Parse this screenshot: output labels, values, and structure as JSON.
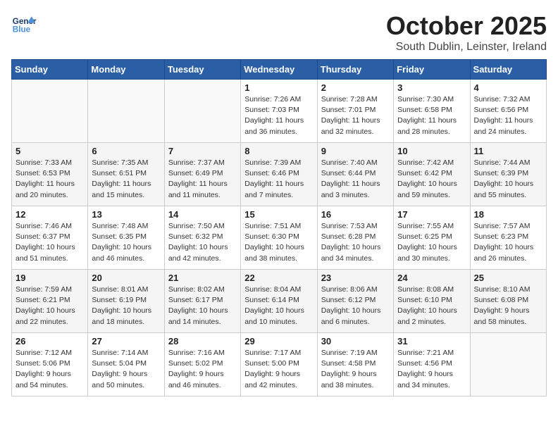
{
  "header": {
    "logo_line1": "General",
    "logo_line2": "Blue",
    "title": "October 2025",
    "subtitle": "South Dublin, Leinster, Ireland"
  },
  "weekdays": [
    "Sunday",
    "Monday",
    "Tuesday",
    "Wednesday",
    "Thursday",
    "Friday",
    "Saturday"
  ],
  "weeks": [
    [
      {
        "day": "",
        "info": ""
      },
      {
        "day": "",
        "info": ""
      },
      {
        "day": "",
        "info": ""
      },
      {
        "day": "1",
        "info": "Sunrise: 7:26 AM\nSunset: 7:03 PM\nDaylight: 11 hours\nand 36 minutes."
      },
      {
        "day": "2",
        "info": "Sunrise: 7:28 AM\nSunset: 7:01 PM\nDaylight: 11 hours\nand 32 minutes."
      },
      {
        "day": "3",
        "info": "Sunrise: 7:30 AM\nSunset: 6:58 PM\nDaylight: 11 hours\nand 28 minutes."
      },
      {
        "day": "4",
        "info": "Sunrise: 7:32 AM\nSunset: 6:56 PM\nDaylight: 11 hours\nand 24 minutes."
      }
    ],
    [
      {
        "day": "5",
        "info": "Sunrise: 7:33 AM\nSunset: 6:53 PM\nDaylight: 11 hours\nand 20 minutes."
      },
      {
        "day": "6",
        "info": "Sunrise: 7:35 AM\nSunset: 6:51 PM\nDaylight: 11 hours\nand 15 minutes."
      },
      {
        "day": "7",
        "info": "Sunrise: 7:37 AM\nSunset: 6:49 PM\nDaylight: 11 hours\nand 11 minutes."
      },
      {
        "day": "8",
        "info": "Sunrise: 7:39 AM\nSunset: 6:46 PM\nDaylight: 11 hours\nand 7 minutes."
      },
      {
        "day": "9",
        "info": "Sunrise: 7:40 AM\nSunset: 6:44 PM\nDaylight: 11 hours\nand 3 minutes."
      },
      {
        "day": "10",
        "info": "Sunrise: 7:42 AM\nSunset: 6:42 PM\nDaylight: 10 hours\nand 59 minutes."
      },
      {
        "day": "11",
        "info": "Sunrise: 7:44 AM\nSunset: 6:39 PM\nDaylight: 10 hours\nand 55 minutes."
      }
    ],
    [
      {
        "day": "12",
        "info": "Sunrise: 7:46 AM\nSunset: 6:37 PM\nDaylight: 10 hours\nand 51 minutes."
      },
      {
        "day": "13",
        "info": "Sunrise: 7:48 AM\nSunset: 6:35 PM\nDaylight: 10 hours\nand 46 minutes."
      },
      {
        "day": "14",
        "info": "Sunrise: 7:50 AM\nSunset: 6:32 PM\nDaylight: 10 hours\nand 42 minutes."
      },
      {
        "day": "15",
        "info": "Sunrise: 7:51 AM\nSunset: 6:30 PM\nDaylight: 10 hours\nand 38 minutes."
      },
      {
        "day": "16",
        "info": "Sunrise: 7:53 AM\nSunset: 6:28 PM\nDaylight: 10 hours\nand 34 minutes."
      },
      {
        "day": "17",
        "info": "Sunrise: 7:55 AM\nSunset: 6:25 PM\nDaylight: 10 hours\nand 30 minutes."
      },
      {
        "day": "18",
        "info": "Sunrise: 7:57 AM\nSunset: 6:23 PM\nDaylight: 10 hours\nand 26 minutes."
      }
    ],
    [
      {
        "day": "19",
        "info": "Sunrise: 7:59 AM\nSunset: 6:21 PM\nDaylight: 10 hours\nand 22 minutes."
      },
      {
        "day": "20",
        "info": "Sunrise: 8:01 AM\nSunset: 6:19 PM\nDaylight: 10 hours\nand 18 minutes."
      },
      {
        "day": "21",
        "info": "Sunrise: 8:02 AM\nSunset: 6:17 PM\nDaylight: 10 hours\nand 14 minutes."
      },
      {
        "day": "22",
        "info": "Sunrise: 8:04 AM\nSunset: 6:14 PM\nDaylight: 10 hours\nand 10 minutes."
      },
      {
        "day": "23",
        "info": "Sunrise: 8:06 AM\nSunset: 6:12 PM\nDaylight: 10 hours\nand 6 minutes."
      },
      {
        "day": "24",
        "info": "Sunrise: 8:08 AM\nSunset: 6:10 PM\nDaylight: 10 hours\nand 2 minutes."
      },
      {
        "day": "25",
        "info": "Sunrise: 8:10 AM\nSunset: 6:08 PM\nDaylight: 9 hours\nand 58 minutes."
      }
    ],
    [
      {
        "day": "26",
        "info": "Sunrise: 7:12 AM\nSunset: 5:06 PM\nDaylight: 9 hours\nand 54 minutes."
      },
      {
        "day": "27",
        "info": "Sunrise: 7:14 AM\nSunset: 5:04 PM\nDaylight: 9 hours\nand 50 minutes."
      },
      {
        "day": "28",
        "info": "Sunrise: 7:16 AM\nSunset: 5:02 PM\nDaylight: 9 hours\nand 46 minutes."
      },
      {
        "day": "29",
        "info": "Sunrise: 7:17 AM\nSunset: 5:00 PM\nDaylight: 9 hours\nand 42 minutes."
      },
      {
        "day": "30",
        "info": "Sunrise: 7:19 AM\nSunset: 4:58 PM\nDaylight: 9 hours\nand 38 minutes."
      },
      {
        "day": "31",
        "info": "Sunrise: 7:21 AM\nSunset: 4:56 PM\nDaylight: 9 hours\nand 34 minutes."
      },
      {
        "day": "",
        "info": ""
      }
    ]
  ]
}
